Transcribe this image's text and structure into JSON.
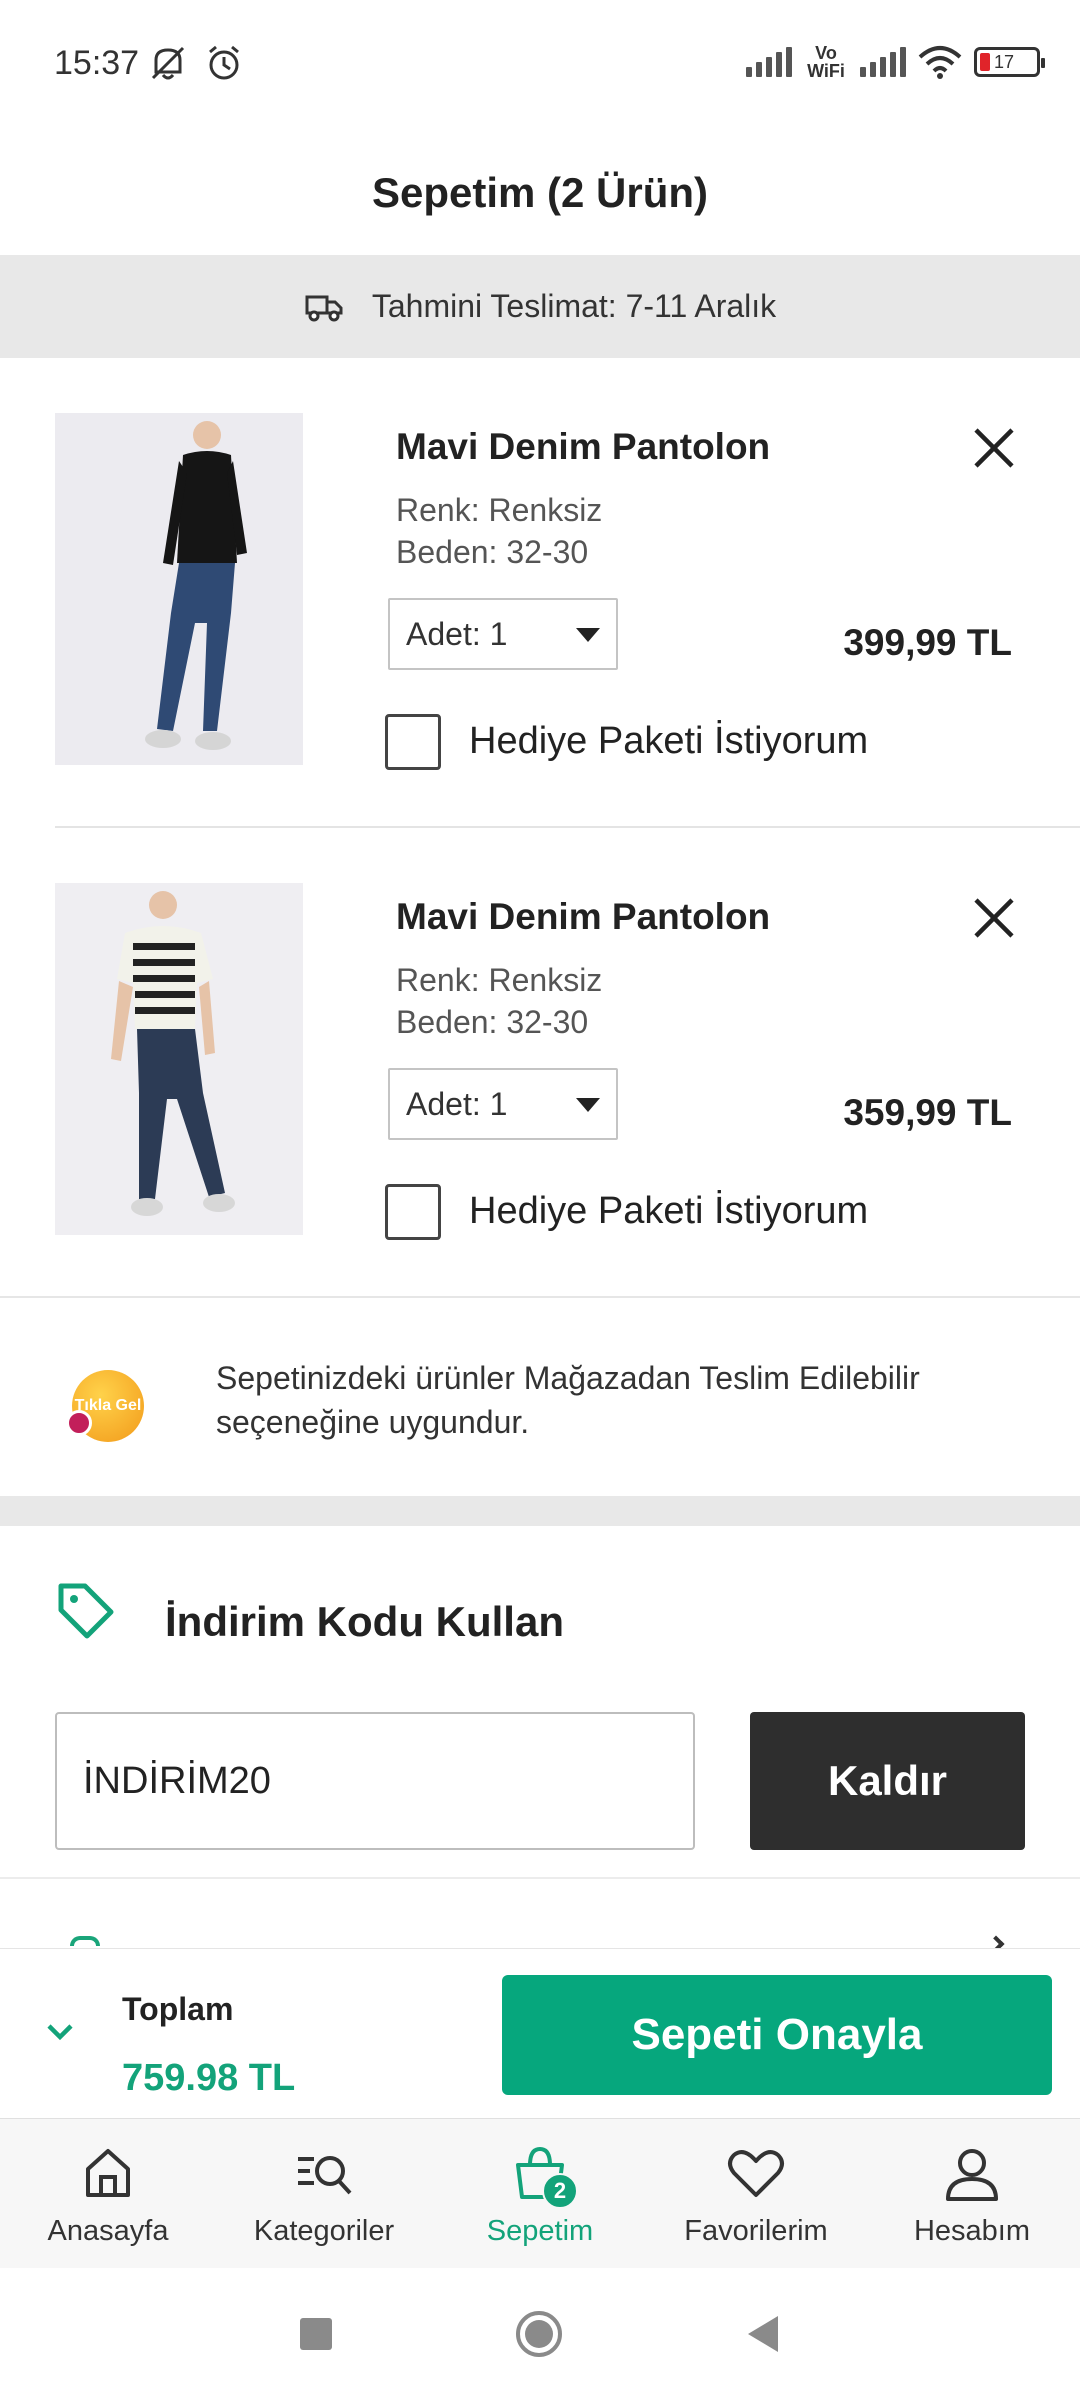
{
  "status_bar": {
    "time": "15:37",
    "network": "Vo WiFi",
    "battery": "17"
  },
  "header": {
    "title": "Sepetim (2 Ürün)"
  },
  "delivery": {
    "text": "Tahmini Teslimat: 7-11 Aralık"
  },
  "cart": {
    "items": [
      {
        "name": "Mavi Denim Pantolon",
        "color": "Renk: Renksiz",
        "size": "Beden: 32-30",
        "quantity": "Adet: 1",
        "price": "399,99 TL",
        "gift_label": "Hediye Paketi İstiyorum"
      },
      {
        "name": "Mavi Denim Pantolon",
        "color": "Renk: Renksiz",
        "size": "Beden: 32-30",
        "quantity": "Adet: 1",
        "price": "359,99 TL",
        "gift_label": "Hediye Paketi İstiyorum"
      }
    ]
  },
  "pickup": {
    "logo_text": "Tıkla Gel",
    "text": "Sepetinizdeki ürünler Mağazadan Teslim Edilebilir seçeneğine uygundur."
  },
  "discount": {
    "title": "İndirim Kodu Kullan",
    "code_value": "İNDİRİM20",
    "remove_label": "Kaldır"
  },
  "summary": {
    "total_label": "Toplam",
    "total_amount": "759.98 TL",
    "confirm_label": "Sepeti Onayla"
  },
  "bottom_nav": {
    "items": [
      {
        "label": "Anasayfa",
        "icon": "home-icon"
      },
      {
        "label": "Kategoriler",
        "icon": "category-search-icon"
      },
      {
        "label": "Sepetim",
        "icon": "cart-bag-icon",
        "badge": "2"
      },
      {
        "label": "Favorilerim",
        "icon": "heart-icon"
      },
      {
        "label": "Hesabım",
        "icon": "user-icon"
      }
    ]
  },
  "colors": {
    "accent": "#06a77d",
    "dark_button": "#2e2e2e",
    "banner_bg": "#e8e8e8"
  }
}
